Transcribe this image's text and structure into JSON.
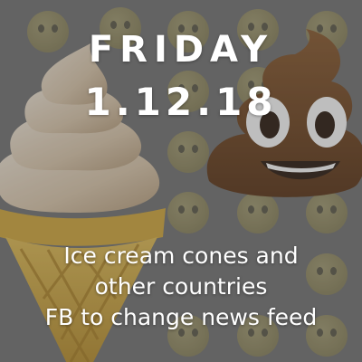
{
  "title": {
    "day": "FRIDAY",
    "date": "1.12.18"
  },
  "headlines": [
    "Ice cream cones and",
    "other countries",
    "FB to change news feed"
  ],
  "images": {
    "left": "ice-cream-cone-emoji",
    "right": "pile-of-poo-emoji",
    "background": "emoji-face-grid"
  },
  "colors": {
    "text": "#ffffff",
    "background": "#737373",
    "cone": "#c9a23a",
    "poop": "#6b3f1d"
  }
}
